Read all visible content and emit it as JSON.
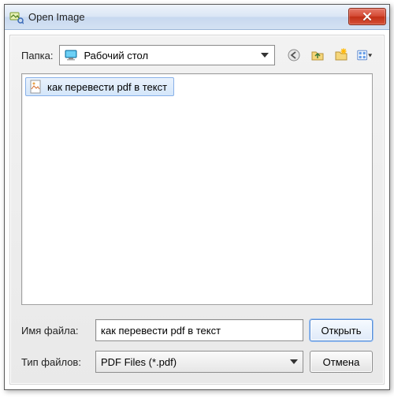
{
  "window": {
    "title": "Open Image"
  },
  "top": {
    "folder_label": "Папка:",
    "location": "Рабочий стол"
  },
  "files": {
    "selected_name": "как перевести pdf в текст"
  },
  "bottom": {
    "filename_label": "Имя файла:",
    "filename_value": "как перевести pdf в текст",
    "filetype_label": "Тип файлов:",
    "filetype_value": "PDF Files (*.pdf)",
    "open_label": "Открыть",
    "cancel_label": "Отмена"
  },
  "icons": {
    "title": "open-image-icon",
    "monitor": "monitor-icon",
    "back": "back-icon",
    "up": "up-folder-icon",
    "new_folder": "new-folder-icon",
    "view_menu": "view-menu-icon",
    "file": "image-file-icon"
  }
}
